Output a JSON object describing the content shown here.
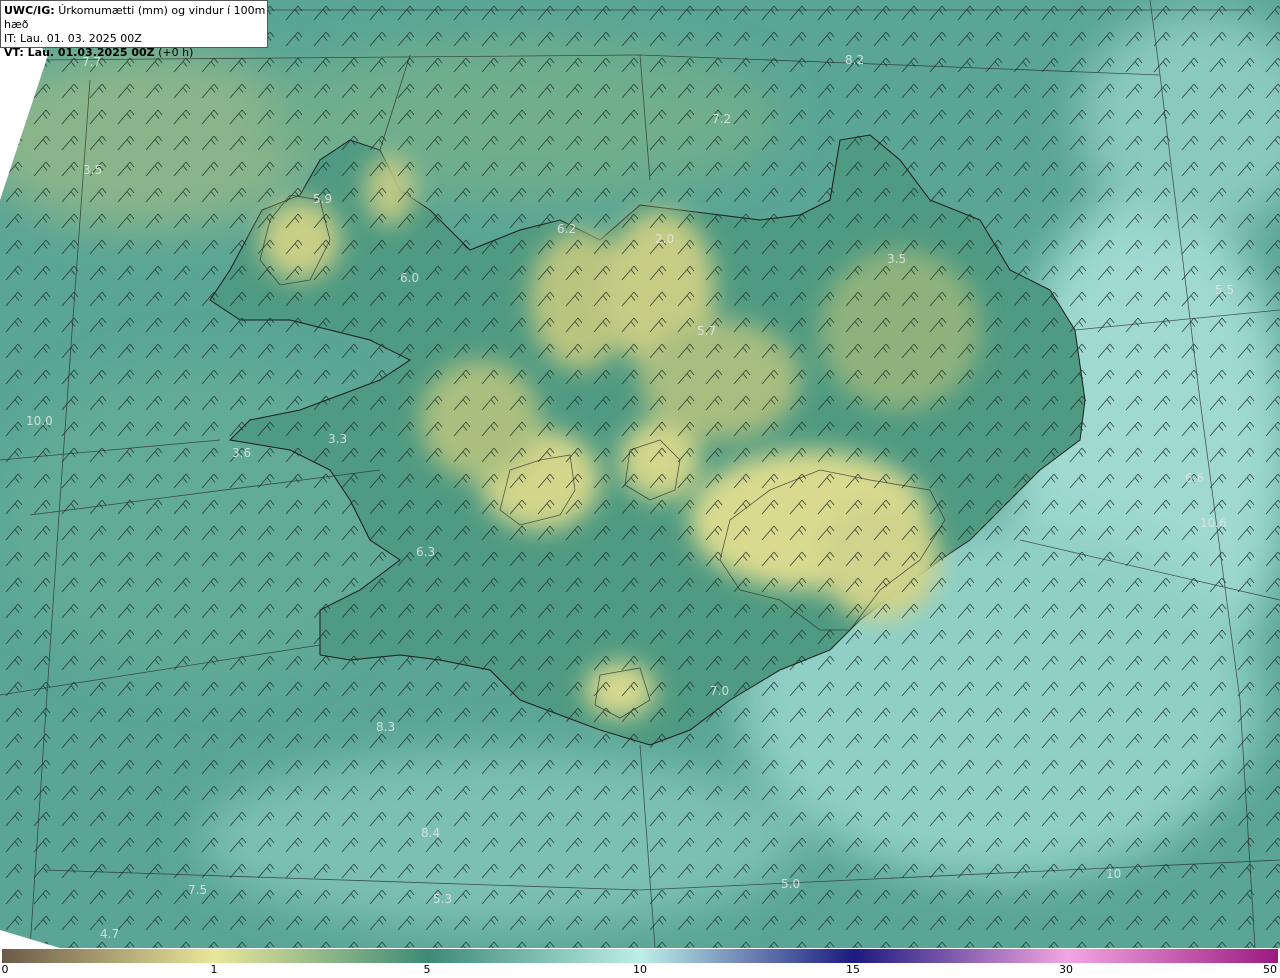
{
  "header": {
    "product": "UWC/IG:",
    "title": "Úrkomumætti (mm) og vindur í 100m hæð",
    "issue_time": "IT: Lau. 01. 03. 2025 00Z",
    "valid_time_label": "VT: Lau. 01.03.2025 00Z",
    "valid_time_offset": " (+0 h)"
  },
  "map_labels": [
    {
      "text": "7.7"
    },
    {
      "text": "3.5"
    },
    {
      "text": "5.9"
    },
    {
      "text": "6.0"
    },
    {
      "text": "6.2"
    },
    {
      "text": "2.0"
    },
    {
      "text": "7.2"
    },
    {
      "text": "8.2"
    },
    {
      "text": "3.5"
    },
    {
      "text": "5.5"
    },
    {
      "text": "5.7"
    },
    {
      "text": "10.0"
    },
    {
      "text": "3.3"
    },
    {
      "text": "3.6"
    },
    {
      "text": "6.3"
    },
    {
      "text": "6.6"
    },
    {
      "text": "10.6"
    },
    {
      "text": "7.0"
    },
    {
      "text": "8.3"
    },
    {
      "text": "8.4"
    },
    {
      "text": "7.5"
    },
    {
      "text": "5.3"
    },
    {
      "text": "4.7"
    },
    {
      "text": "5.0"
    },
    {
      "text": "10"
    }
  ],
  "colorbar": {
    "ticks": [
      "0",
      "1",
      "5",
      "10",
      "15",
      "30",
      "50"
    ],
    "values": [
      0,
      1,
      5,
      10,
      15,
      30,
      50
    ],
    "colors": {
      "brown": "#6b5a48",
      "yellow": "#e9e79a",
      "teal": "#3c8a76",
      "cyan": "#bdeee8",
      "navy": "#1c1a80",
      "pink": "#f2a6e0",
      "purple": "#9a1a80"
    }
  }
}
